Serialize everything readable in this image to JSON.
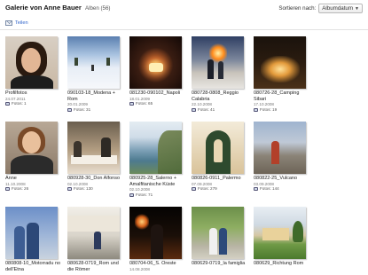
{
  "header": {
    "title": "Galerie von Anne Bauer",
    "album_count": "Alben (56)",
    "sort_label": "Sortieren nach:",
    "sort_value": "Albumdatum"
  },
  "share": {
    "label": "Teilen"
  },
  "albums": [
    {
      "name": "Profilfotos",
      "date": "24.07.2011",
      "fotos": "Fotos: 1"
    },
    {
      "name": "090103-18_Modena + Rom",
      "date": "20.01.2009",
      "fotos": "Fotos: 31"
    },
    {
      "name": "081230-090102_Napoli",
      "date": "18.01.2009",
      "fotos": "Fotos: 65"
    },
    {
      "name": "080728-0808_Reggio Calabria",
      "date": "22.10.2008",
      "fotos": "Fotos: 41"
    },
    {
      "name": "080726-28_Camping Sibari",
      "date": "17.10.2008",
      "fotos": "Fotos: 19"
    },
    {
      "name": "Anne",
      "date": "11.10.2008",
      "fotos": "Fotos: 26"
    },
    {
      "name": "080928-30_Don Alfonso",
      "date": "02.10.2008",
      "fotos": "Fotos: 130"
    },
    {
      "name": "080925-28_Salerno + Amalfitanische Küste",
      "date": "02.10.2008",
      "fotos": "Fotos: 71"
    },
    {
      "name": "080826-0911_Palermo",
      "date": "07.09.2008",
      "fotos": "Fotos: 279"
    },
    {
      "name": "080822-25_Vulcano",
      "date": "03.09.2008",
      "fotos": "Fotos: 144"
    },
    {
      "name": "080808-10_Motorradu no dell'Etna",
      "date": "",
      "fotos": ""
    },
    {
      "name": "080628-0719_Rom und die Römer",
      "date": "",
      "fotos": ""
    },
    {
      "name": "080704-06_S. Oreste",
      "date": "14.08.2008",
      "fotos": ""
    },
    {
      "name": "080629-0719_la famiglia",
      "date": "",
      "fotos": ""
    },
    {
      "name": "080629_Richtung Rom",
      "date": "",
      "fotos": ""
    }
  ]
}
